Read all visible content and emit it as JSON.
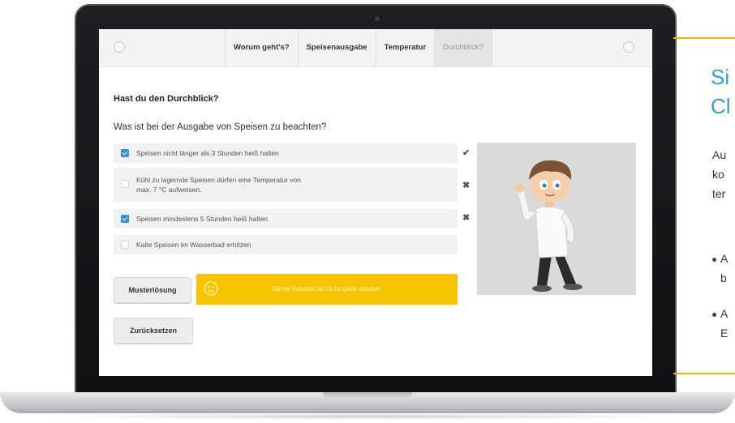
{
  "nav": {
    "tabs": [
      "Worum geht's?",
      "Speisenausgabe",
      "Temperatur",
      "Durchblick?"
    ],
    "active_tab_index": 3
  },
  "quiz": {
    "heading": "Hast du den Durchblick?",
    "question": "Was ist bei der Ausgabe von Speisen zu beachten?",
    "answers": [
      {
        "text": "Speisen nicht länger als 3 Stunden heiß halten",
        "checked": true,
        "result": "✔"
      },
      {
        "text_line1": "Kühl zu lagernde Speisen dürfen eine Temperatur von",
        "text_line2": "max. 7 °C aufweisen.",
        "checked": false,
        "result": "✖"
      },
      {
        "text": "Speisen mindestens 5 Stunden heiß halten",
        "checked": true,
        "result": "✖"
      },
      {
        "text": "Kalte Speisen im Wasserbad erhitzen",
        "checked": false,
        "result": ""
      }
    ],
    "solution_button": "Musterlösung",
    "feedback_text": "Deine Antwort ist nicht ganz sauber.",
    "reset_button": "Zurücksetzen"
  },
  "side": {
    "title_line1": "Si",
    "title_line2": "Cl",
    "body_lines": [
      "Au",
      "ko",
      "ter"
    ],
    "bullets": [
      [
        "A",
        "b"
      ],
      [
        "A",
        "E"
      ]
    ]
  },
  "colors": {
    "accent_blue": "#2f8fd8",
    "feedback_yellow": "#f7c400",
    "rule_gold": "#f2b400",
    "title_blue": "#2f9fd6"
  }
}
